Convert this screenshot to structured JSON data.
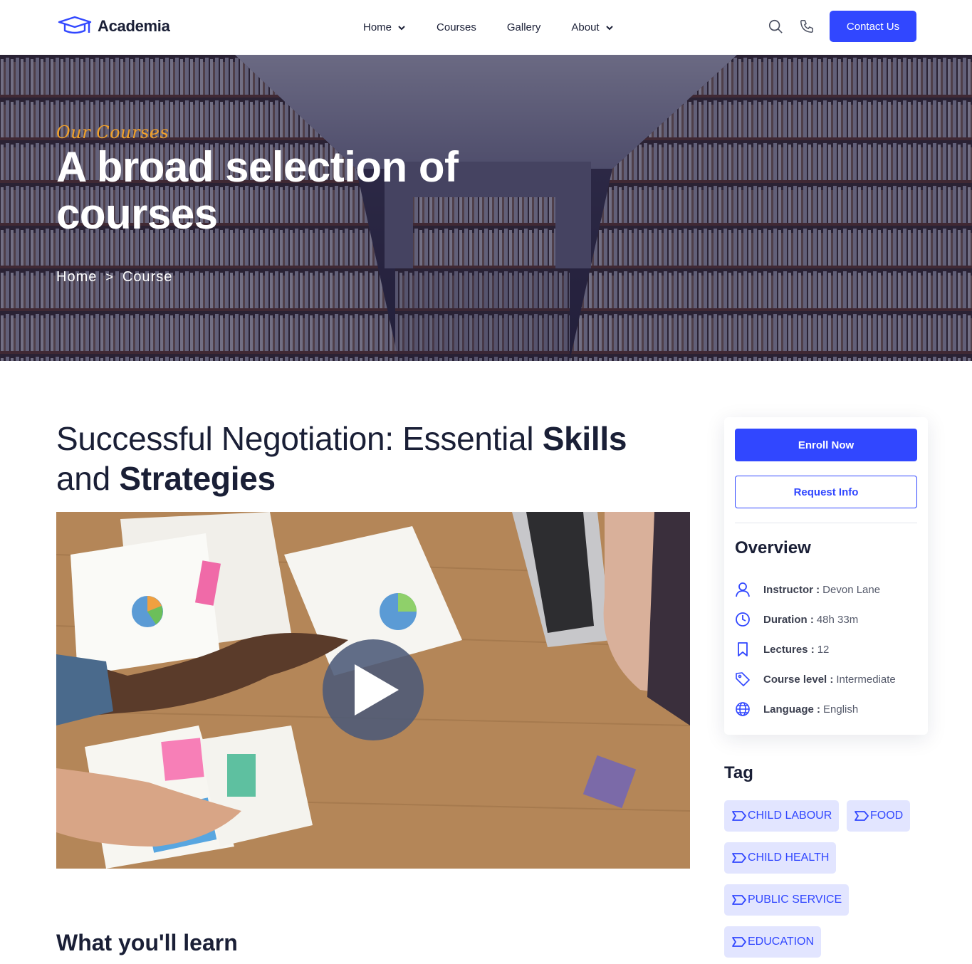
{
  "brand": {
    "name": "Academia"
  },
  "nav": {
    "items": [
      {
        "label": "Home",
        "has_dropdown": true
      },
      {
        "label": "Courses",
        "has_dropdown": false
      },
      {
        "label": "Gallery",
        "has_dropdown": false
      },
      {
        "label": "About",
        "has_dropdown": true
      }
    ],
    "search_icon": "search-icon",
    "phone_icon": "phone-icon",
    "contact_label": "Contact Us"
  },
  "hero": {
    "eyebrow": "Our Courses",
    "title": "A broad selection of courses",
    "breadcrumb": {
      "home": "Home",
      "separator": ">",
      "current": "Course"
    }
  },
  "course": {
    "title_part1": "Successful Negotiation: Essential ",
    "title_bold1": "Skills",
    "title_part2": "and ",
    "title_bold2": "Strategies",
    "video_icon": "play-icon",
    "learn_heading": "What you'll learn"
  },
  "sidebar": {
    "enroll_label": "Enroll Now",
    "request_label": "Request Info",
    "overview_title": "Overview",
    "overview": [
      {
        "icon": "user-icon",
        "key": "Instructor :",
        "value": "Devon Lane"
      },
      {
        "icon": "clock-icon",
        "key": "Duration :",
        "value": "48h 33m"
      },
      {
        "icon": "bookmark-icon",
        "key": "Lectures :",
        "value": "12"
      },
      {
        "icon": "tag-icon",
        "key": "Course level :",
        "value": "Intermediate"
      },
      {
        "icon": "globe-icon",
        "key": "Language :",
        "value": "English"
      }
    ],
    "tag_title": "Tag",
    "tags": [
      "CHILD LABOUR",
      "FOOD",
      "CHILD HEALTH",
      "PUBLIC SERVICE",
      "EDUCATION"
    ]
  },
  "colors": {
    "accent": "#3147ff",
    "eyebrow": "#f2a12a",
    "tag_bg": "#e2e5ff",
    "text_dark": "#1a1f36"
  }
}
